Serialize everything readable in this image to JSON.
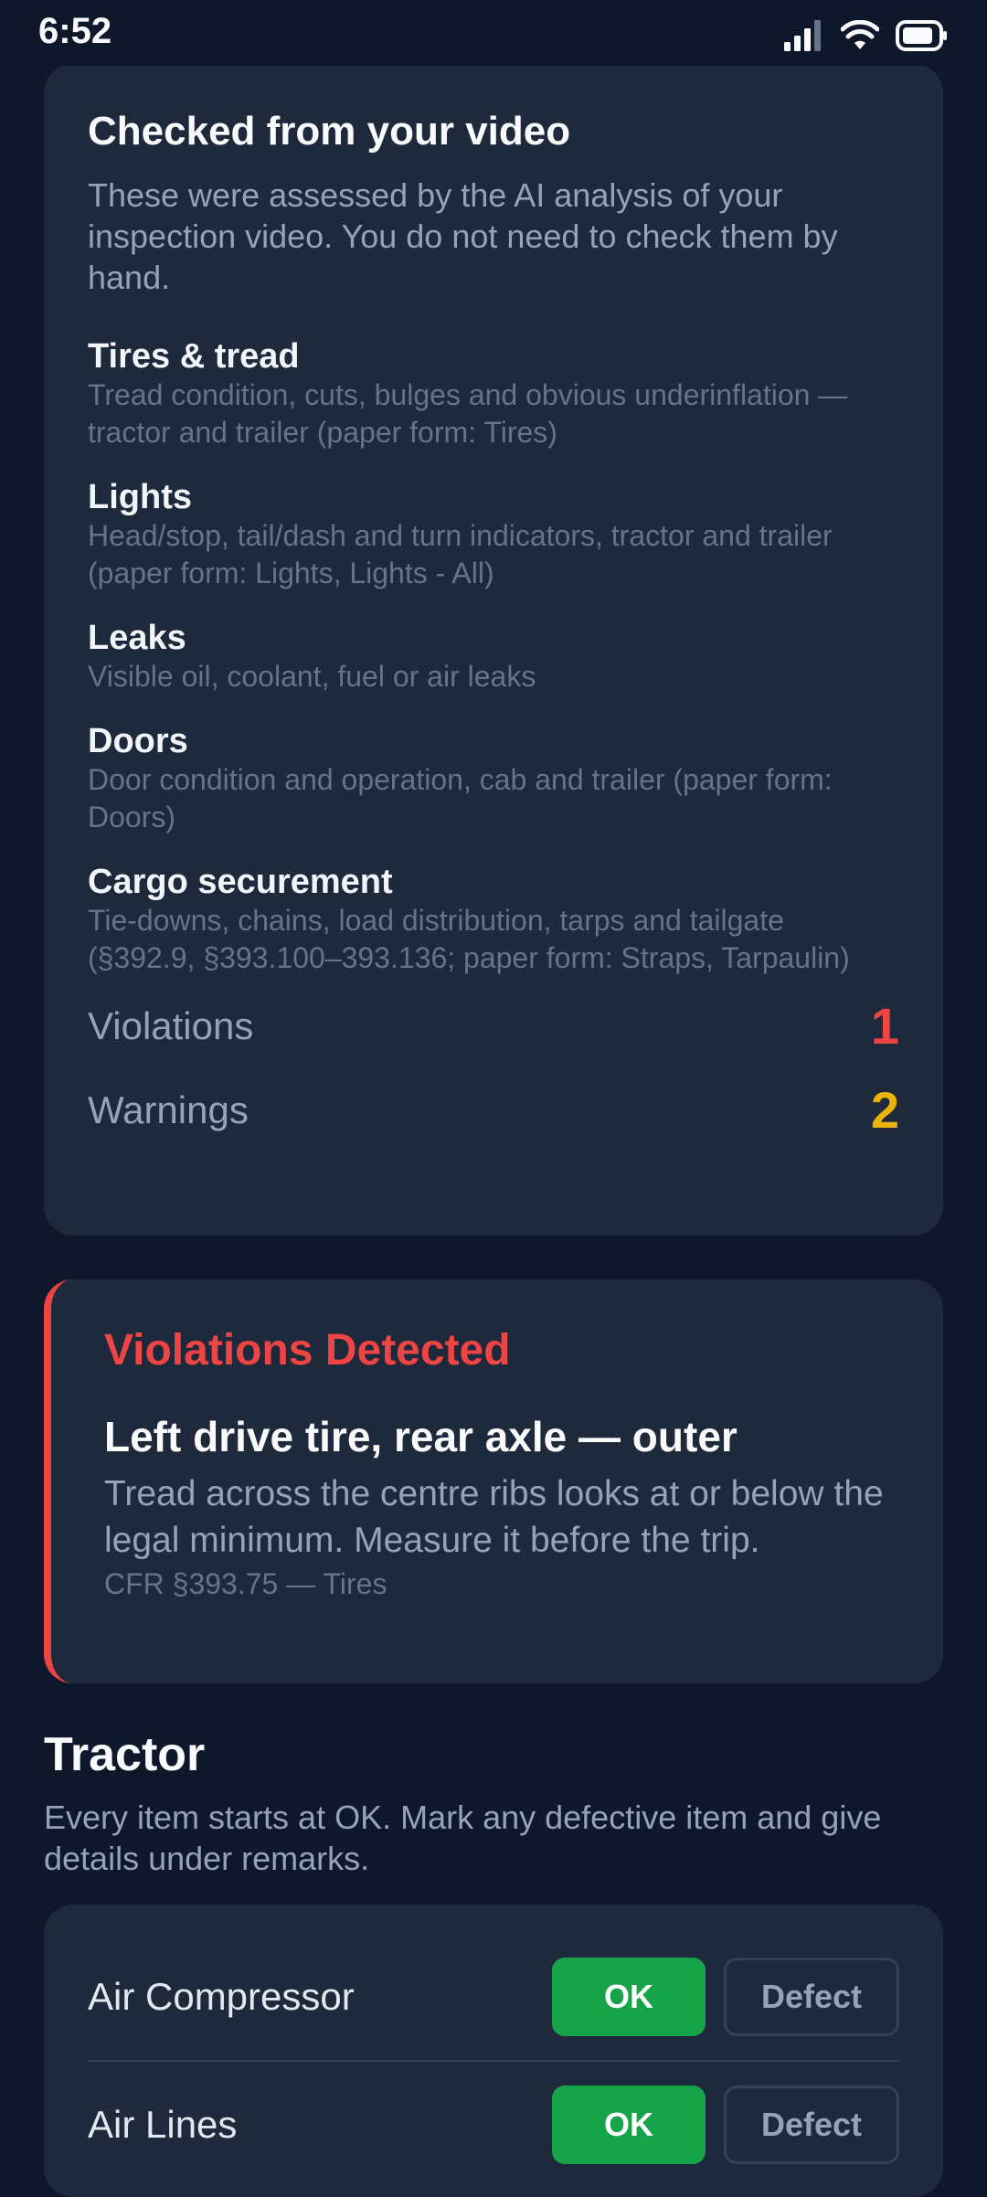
{
  "status_bar": {
    "time": "6:52",
    "icons": [
      "signal-icon",
      "wifi-icon",
      "battery-icon"
    ]
  },
  "checked_card": {
    "title": "Checked from your video",
    "intro": "These were assessed by the AI analysis of your inspection video. You do not need to check them by hand.",
    "items": [
      {
        "title": "Tires & tread",
        "desc": "Tread condition, cuts, bulges and obvious underinflation — tractor and trailer (paper form: Tires)"
      },
      {
        "title": "Lights",
        "desc": "Head/stop, tail/dash and turn indicators, tractor and trailer (paper form: Lights, Lights - All)"
      },
      {
        "title": "Leaks",
        "desc": "Visible oil, coolant, fuel or air leaks"
      },
      {
        "title": "Doors",
        "desc": "Door condition and operation, cab and trailer (paper form: Doors)"
      },
      {
        "title": "Cargo securement",
        "desc": "Tie-downs, chains, load distribution, tarps and tailgate (§392.9, §393.100–393.136; paper form: Straps, Tarpaulin)"
      }
    ],
    "violations_label": "Violations",
    "violations_count": "1",
    "warnings_label": "Warnings",
    "warnings_count": "2"
  },
  "violation_card": {
    "heading": "Violations Detected",
    "item_title": "Left drive tire, rear axle — outer",
    "item_desc": "Tread across the centre ribs looks at or below the legal minimum. Measure it before the trip.",
    "item_ref": "CFR §393.75 — Tires"
  },
  "tractor_section": {
    "title": "Tractor",
    "desc": "Every item starts at OK. Mark any defective item and give details under remarks.",
    "rows": [
      {
        "label": "Air Compressor",
        "ok_label": "OK",
        "defect_label": "Defect"
      },
      {
        "label": "Air Lines",
        "ok_label": "OK",
        "defect_label": "Defect"
      }
    ]
  },
  "colors": {
    "background": "#0f172a",
    "card": "#1e293b",
    "violation": "#ef4444",
    "warning": "#eab308",
    "ok": "#16a34a"
  }
}
